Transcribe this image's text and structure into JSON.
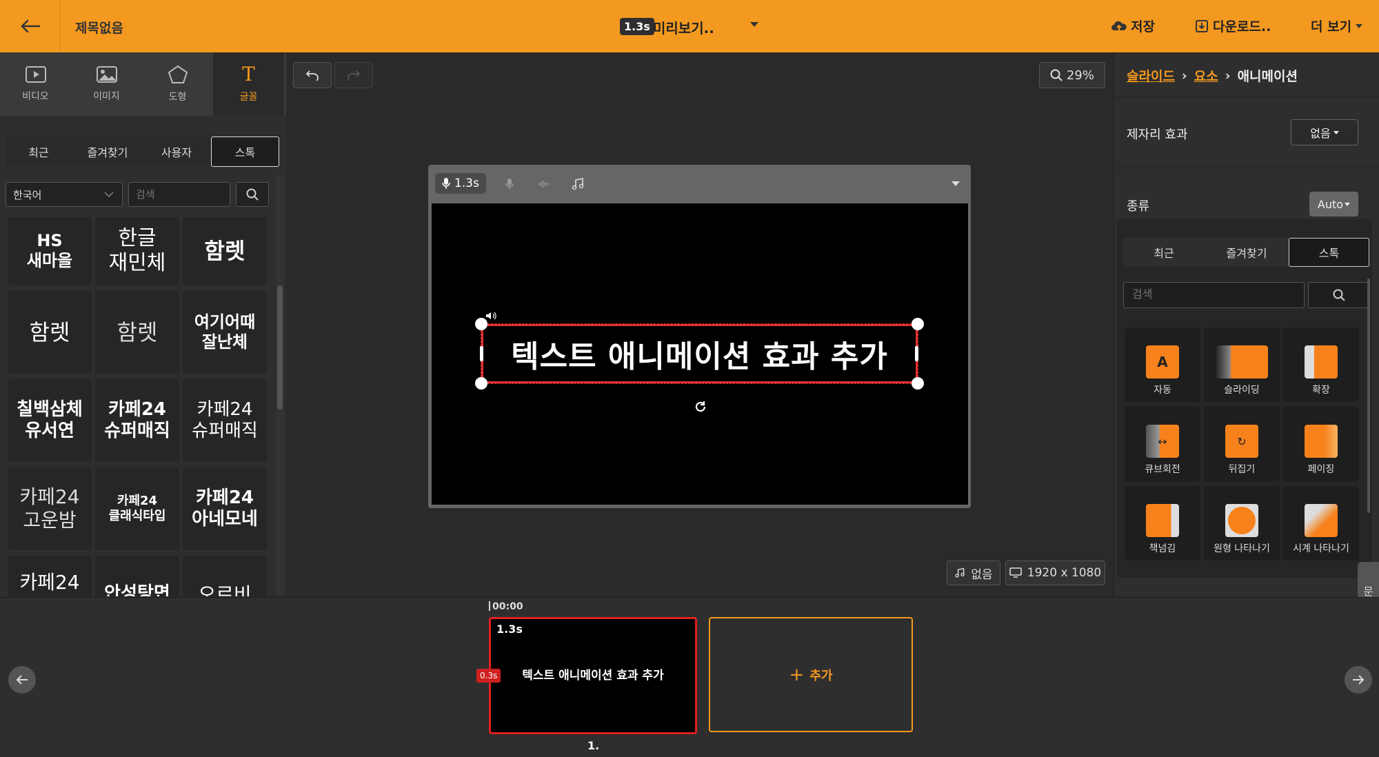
{
  "topbar": {
    "title": "제목없음",
    "duration_badge": "1.3s",
    "preview_label": "미리보기..",
    "save_label": "저장",
    "download_label": "다운로드..",
    "more_label": "더 보기",
    "accent_color": "#f4991f"
  },
  "left_tabs": [
    {
      "label": "비디오",
      "icon": "video-icon"
    },
    {
      "label": "이미지",
      "icon": "image-icon"
    },
    {
      "label": "도형",
      "icon": "pentagon-icon"
    },
    {
      "label": "글꼴",
      "icon": "text-icon",
      "active": true
    }
  ],
  "font_sub_tabs": [
    "최근",
    "즐겨찾기",
    "사용자",
    "스톡"
  ],
  "font_sub_tab_active": "스톡",
  "language_select": {
    "value": "한국어"
  },
  "font_search": {
    "placeholder": "검색"
  },
  "fonts": [
    "HS\n새마을",
    "한글\n재민체",
    "함렛",
    "함렛",
    "함렛",
    "여기어때\n잘난체",
    "칠백삼체\n유서연",
    "카페24\n슈퍼매직",
    "카페24\n슈퍼매직",
    "카페24\n고운밤",
    "카페24\n클래식타입",
    "카페24\n아네모네",
    "카페24",
    "안성탕면",
    "오르비"
  ],
  "canvas": {
    "zoom": "29%",
    "voice_duration": "1.3s",
    "text_element": "텍스트 애니메이션 효과 추가",
    "bgm_label": "없음",
    "resolution": "1920 x 1080"
  },
  "right_panel": {
    "breadcrumb": [
      "슬라이드",
      "요소",
      "애니메이션"
    ],
    "place_effect_label": "제자리 효과",
    "place_effect_value": "없음",
    "type_label": "종류",
    "type_value": "Auto",
    "anim_tabs": [
      "최근",
      "즐겨찾기",
      "스톡"
    ],
    "anim_tab_active": "스톡",
    "anim_search_placeholder": "검색",
    "animations": [
      "자동",
      "슬라이딩",
      "확장",
      "큐브회전",
      "뒤집기",
      "페이징",
      "책넘김",
      "원형 나타나기",
      "시계 나타나기"
    ],
    "help_label": "문의"
  },
  "timeline": {
    "time_marker": "00:00",
    "scene_duration": "1.3s",
    "scene_start_badge": "0.3s",
    "scene_text": "텍스트 애니메이션 효과 추가",
    "scene_number": "1.",
    "add_label": "추가"
  }
}
